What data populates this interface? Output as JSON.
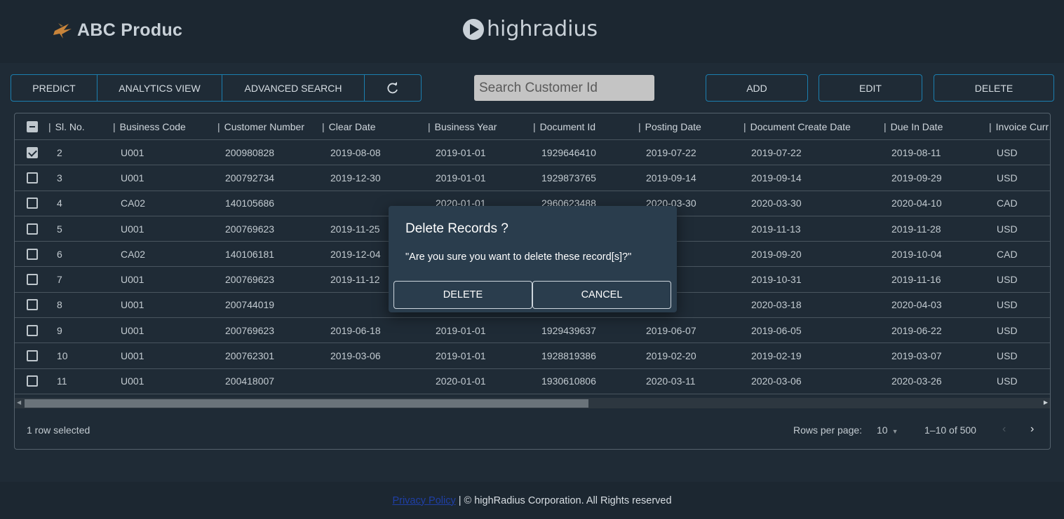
{
  "header": {
    "brand_name": "ABC Produc",
    "partner_logo_text": "highradius"
  },
  "toolbar": {
    "predict_label": "PREDICT",
    "analytics_label": "ANALYTICS VIEW",
    "advanced_search_label": "ADVANCED SEARCH",
    "refresh_icon": "refresh-icon",
    "search_placeholder": "Search Customer Id",
    "add_label": "ADD",
    "edit_label": "EDIT",
    "delete_label": "DELETE"
  },
  "table": {
    "columns": [
      "Sl. No.",
      "Business Code",
      "Customer Number",
      "Clear Date",
      "Business Year",
      "Document Id",
      "Posting Date",
      "Document Create Date",
      "Due In Date",
      "Invoice Curr"
    ],
    "rows": [
      {
        "checked": true,
        "sl": "2",
        "business_code": "U001",
        "customer_number": "200980828",
        "clear_date": "2019-08-08",
        "business_year": "2019-01-01",
        "document_id": "1929646410",
        "posting_date": "2019-07-22",
        "document_create_date": "2019-07-22",
        "due_in_date": "2019-08-11",
        "invoice_currency": "USD"
      },
      {
        "checked": false,
        "sl": "3",
        "business_code": "U001",
        "customer_number": "200792734",
        "clear_date": "2019-12-30",
        "business_year": "2019-01-01",
        "document_id": "1929873765",
        "posting_date": "2019-09-14",
        "document_create_date": "2019-09-14",
        "due_in_date": "2019-09-29",
        "invoice_currency": "USD"
      },
      {
        "checked": false,
        "sl": "4",
        "business_code": "CA02",
        "customer_number": "140105686",
        "clear_date": "",
        "business_year": "2020-01-01",
        "document_id": "2960623488",
        "posting_date": "2020-03-30",
        "document_create_date": "2020-03-30",
        "due_in_date": "2020-04-10",
        "invoice_currency": "CAD"
      },
      {
        "checked": false,
        "sl": "5",
        "business_code": "U001",
        "customer_number": "200769623",
        "clear_date": "2019-11-25",
        "business_year": "",
        "document_id": "",
        "posting_date": "1-13",
        "document_create_date": "2019-11-13",
        "due_in_date": "2019-11-28",
        "invoice_currency": "USD"
      },
      {
        "checked": false,
        "sl": "6",
        "business_code": "CA02",
        "customer_number": "140106181",
        "clear_date": "2019-12-04",
        "business_year": "",
        "document_id": "",
        "posting_date": "9-20",
        "document_create_date": "2019-09-20",
        "due_in_date": "2019-10-04",
        "invoice_currency": "CAD"
      },
      {
        "checked": false,
        "sl": "7",
        "business_code": "U001",
        "customer_number": "200769623",
        "clear_date": "2019-11-12",
        "business_year": "",
        "document_id": "",
        "posting_date": "1-01",
        "document_create_date": "2019-10-31",
        "due_in_date": "2019-11-16",
        "invoice_currency": "USD"
      },
      {
        "checked": false,
        "sl": "8",
        "business_code": "U001",
        "customer_number": "200744019",
        "clear_date": "",
        "business_year": "",
        "document_id": "",
        "posting_date": "3-19",
        "document_create_date": "2020-03-18",
        "due_in_date": "2020-04-03",
        "invoice_currency": "USD"
      },
      {
        "checked": false,
        "sl": "9",
        "business_code": "U001",
        "customer_number": "200769623",
        "clear_date": "2019-06-18",
        "business_year": "2019-01-01",
        "document_id": "1929439637",
        "posting_date": "2019-06-07",
        "document_create_date": "2019-06-05",
        "due_in_date": "2019-06-22",
        "invoice_currency": "USD"
      },
      {
        "checked": false,
        "sl": "10",
        "business_code": "U001",
        "customer_number": "200762301",
        "clear_date": "2019-03-06",
        "business_year": "2019-01-01",
        "document_id": "1928819386",
        "posting_date": "2019-02-20",
        "document_create_date": "2019-02-19",
        "due_in_date": "2019-03-07",
        "invoice_currency": "USD"
      },
      {
        "checked": false,
        "sl": "11",
        "business_code": "U001",
        "customer_number": "200418007",
        "clear_date": "",
        "business_year": "2020-01-01",
        "document_id": "1930610806",
        "posting_date": "2020-03-11",
        "document_create_date": "2020-03-06",
        "due_in_date": "2020-03-26",
        "invoice_currency": "USD"
      }
    ],
    "selection_text": "1 row selected",
    "rows_per_page_label": "Rows per page:",
    "rows_per_page_value": "10",
    "page_range": "1–10 of 500"
  },
  "dialog": {
    "title": "Delete Records ?",
    "message": "\"Are you sure you want to delete these record[s]?\"",
    "delete_label": "DELETE",
    "cancel_label": "CANCEL"
  },
  "footer": {
    "privacy_link": "Privacy Policy",
    "copyright": " | © highRadius Corporation. All Rights reserved"
  },
  "colors": {
    "background": "#1f2b36",
    "accent_border": "#1b7fb0",
    "dialog_bg": "#2a3d4d"
  }
}
